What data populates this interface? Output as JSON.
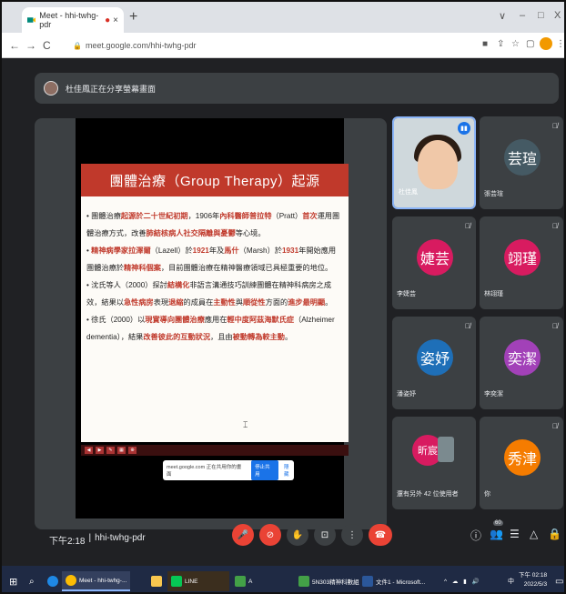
{
  "browser": {
    "tab_title": "Meet - hhi-twhg-pdr",
    "new_tab": "+",
    "window_controls": {
      "minimize": "–",
      "restore": "□",
      "close": "X",
      "caret": "∨"
    },
    "url": "meet.google.com/hhi-twhg-pdr",
    "nav": {
      "back": "←",
      "forward": "→",
      "reload": "C"
    }
  },
  "meet": {
    "presenter_banner": "杜佳鳳正在分享螢幕畫面",
    "meeting_time": "下午2:18",
    "separator": "|",
    "meeting_code": "hhi-twhg-pdr",
    "share_popup": {
      "text": "meet.google.com 正在共用你的畫面",
      "stop": "停止共用",
      "hide": "隱藏"
    }
  },
  "slide": {
    "title": "團體治療（Group Therapy）起源",
    "paragraphs": [
      [
        {
          "t": "• 團體治療"
        },
        {
          "t": "起源於二十世紀初期",
          "hl": true
        },
        {
          "t": "，1906年"
        },
        {
          "t": "內科醫師普拉特",
          "hl": true
        },
        {
          "t": "（Pratt）"
        },
        {
          "t": "首次",
          "hl": true
        },
        {
          "t": "運用團體治療方式，改善"
        },
        {
          "t": "肺結核病人社交隔離與憂鬱",
          "hl": true
        },
        {
          "t": "等心境。"
        }
      ],
      [
        {
          "t": "• "
        },
        {
          "t": "精神病學家拉澤爾",
          "hl": true
        },
        {
          "t": "（Lazell）於"
        },
        {
          "t": "1921",
          "hl": true
        },
        {
          "t": "年及"
        },
        {
          "t": "馬什",
          "hl": true
        },
        {
          "t": "（Marsh）於"
        },
        {
          "t": "1931",
          "hl": true
        },
        {
          "t": "年開始應用團體治療於"
        },
        {
          "t": "精神科個案",
          "hl": true
        },
        {
          "t": "，目前團體治療在精神醫療領域已具極重要的地位。"
        }
      ],
      [
        {
          "t": "• 沈氏等人（2000）探討"
        },
        {
          "t": "結構化",
          "hl": true
        },
        {
          "t": "非語言溝通技巧訓練團體在精神科病房之成效，結果以"
        },
        {
          "t": "急性病房",
          "hl": true
        },
        {
          "t": "表現"
        },
        {
          "t": "退縮",
          "hl": true
        },
        {
          "t": "的成員在"
        },
        {
          "t": "主動性",
          "hl": true
        },
        {
          "t": "與"
        },
        {
          "t": "順從性",
          "hl": true
        },
        {
          "t": "方面的"
        },
        {
          "t": "進步最明顯",
          "hl": true
        },
        {
          "t": "。"
        }
      ],
      [
        {
          "t": "• 徐氏（2000）以"
        },
        {
          "t": "現實導向團體治療",
          "hl": true
        },
        {
          "t": "應用在"
        },
        {
          "t": "輕中度阿茲海默氏症",
          "hl": true
        },
        {
          "t": "（Alzheimer dementia），結果"
        },
        {
          "t": "改善彼此的互動狀況",
          "hl": true
        },
        {
          "t": "，且由"
        },
        {
          "t": "被動轉為較主動",
          "hl": true
        },
        {
          "t": "。"
        }
      ]
    ]
  },
  "participants": [
    {
      "name": "杜佳鳳",
      "initial": "",
      "color": "",
      "self_video": true
    },
    {
      "name": "張芸瑄",
      "initial": "芸瑄",
      "color": "#455a64"
    },
    {
      "name": "李婕芸",
      "initial": "婕芸",
      "color": "#d81b60"
    },
    {
      "name": "林翊瑾",
      "initial": "翊瑾",
      "color": "#d81b60"
    },
    {
      "name": "潘姿妤",
      "initial": "姿妤",
      "color": "#1e6fb8"
    },
    {
      "name": "李奕潔",
      "initial": "奕潔",
      "color": "#a241b8"
    },
    {
      "name": "還有另外 42 位使用者",
      "initial": "昕宸",
      "color": "#d81b60"
    },
    {
      "name": "你",
      "initial": "秀津",
      "color": "#f57c00"
    }
  ],
  "controls": {
    "mic": "mic-off",
    "camera": "camera-off",
    "hand": "raise-hand",
    "present": "present",
    "more": "more",
    "hangup": "hang-up"
  },
  "right_controls": {
    "info": "ⓘ",
    "people_count": "60",
    "people": "people",
    "chat": "chat",
    "activities": "activities",
    "lock": "host-controls"
  },
  "taskbar": {
    "items": [
      {
        "label": "Meet - hhi-twhg-..."
      },
      {
        "label": "LINE"
      },
      {
        "label": "A"
      },
      {
        "label": "5N303精神科數組"
      },
      {
        "label": "文件1 - Microsoft..."
      }
    ],
    "time": "下午 02:18",
    "date": "2022/5/3",
    "ime": "中"
  },
  "colors": {
    "accent_red": "#ea4335",
    "slide_red": "#c0392b",
    "meet_bg": "#202124",
    "tile_bg": "#3c4043"
  }
}
